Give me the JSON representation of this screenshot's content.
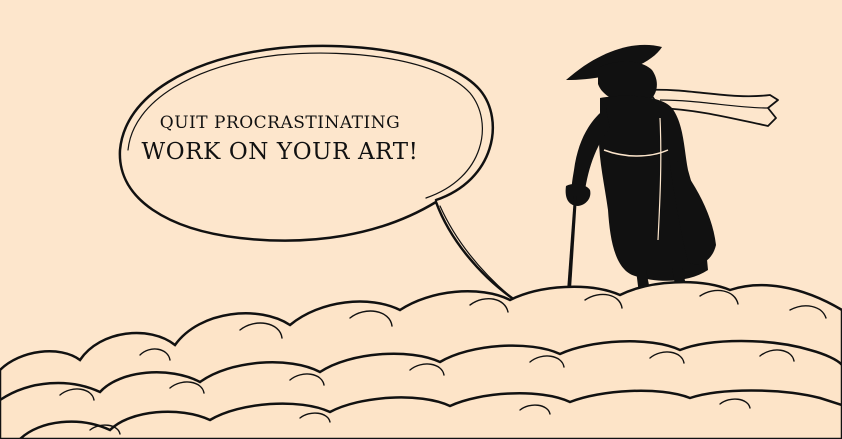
{
  "speech_bubble": {
    "line1": "QUIT PROCRASTINATING",
    "line2": "WORK ON YOUR ART!"
  },
  "colors": {
    "background": "#fde6cc",
    "ink": "#111111",
    "cloud_fill": "#fde4c8"
  }
}
